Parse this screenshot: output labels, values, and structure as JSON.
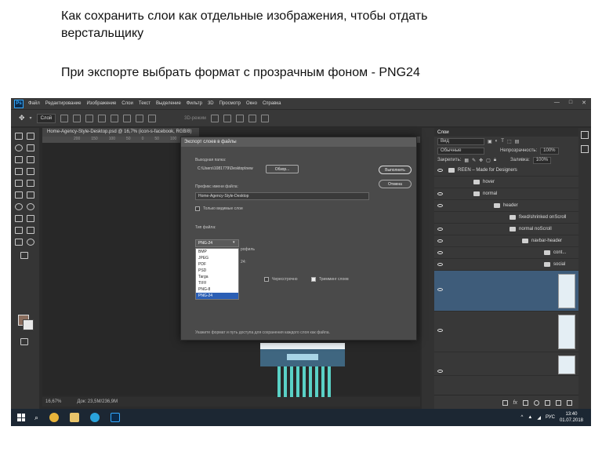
{
  "caption": {
    "line1": "Как сохранить слои как отдельные изображения, чтобы отдать верстальщику",
    "line2": "При экспорте выбрать формат с прозрачным фоном - PNG24"
  },
  "app": {
    "logo": "Ps",
    "menu": [
      "Файл",
      "Редактирование",
      "Изображение",
      "Слои",
      "Текст",
      "Выделение",
      "Фильтр",
      "3D",
      "Просмотр",
      "Окно",
      "Справка"
    ],
    "window_controls": [
      "—",
      "□",
      "✕"
    ]
  },
  "options_bar": {
    "layer_select": "Слой",
    "mode_3d": "3D-режим"
  },
  "document": {
    "tab_title": "Home-Agency-Style-Desktop.psd @ 16,7% (icon-s-facebook, RGB/8)",
    "ruler_ticks": [
      "200",
      "150",
      "100",
      "50",
      "0",
      "50",
      "100",
      "150"
    ],
    "zoom": "16,67%",
    "doc_info": "Док: 23,5M/236,9M"
  },
  "dialog": {
    "title": "Экспорт слоев в файлы",
    "dest_label": "Выходная папка:",
    "dest_value": "C:\\Users\\1081779\\Desktop\\new",
    "browse_btn": "Обзор...",
    "run_btn": "Выполнить",
    "cancel_btn": "Отмена",
    "prefix_label": "Префикс имени файла:",
    "prefix_value": "Home-Agency-Style-Desktop",
    "visible_only": "Только видимые слои",
    "filetype_label": "Тип файла:",
    "filetype_selected": "PNG-24",
    "filetype_options": [
      "BMP",
      "JPEG",
      "PDF",
      "PSD",
      "Targa",
      "TIFF",
      "PNG-8",
      "PNG-24"
    ],
    "profile_partial": "рофиль",
    "options_partial": "24:",
    "interlaced": "Чересстрочно",
    "trim_layers": "Тримминг слоев",
    "hint": "Укажите формат и путь доступа для сохранения каждого слоя как файла."
  },
  "layers_panel": {
    "tab": "Слои",
    "filter": "Вид",
    "blend_mode": "Обычные",
    "opacity_label": "Непрозрачность:",
    "opacity_value": "100%",
    "lock_label": "Закрепить:",
    "fill_label": "Заливка:",
    "fill_value": "100%",
    "layers": [
      {
        "label": "REEN – Made for Designers",
        "indent": 0
      },
      {
        "label": "hover",
        "indent": 1
      },
      {
        "label": "normal",
        "indent": 1
      },
      {
        "label": "header",
        "indent": 2
      },
      {
        "label": "fixed/shrinked onScroll",
        "indent": 3
      },
      {
        "label": "normal noScroll",
        "indent": 3
      },
      {
        "label": "navbar-header",
        "indent": 4
      },
      {
        "label": "cont...",
        "indent": 5
      },
      {
        "label": "social",
        "indent": 5
      }
    ]
  },
  "taskbar": {
    "lang": "РУС",
    "time": "13:40",
    "date": "01.07.2018"
  }
}
